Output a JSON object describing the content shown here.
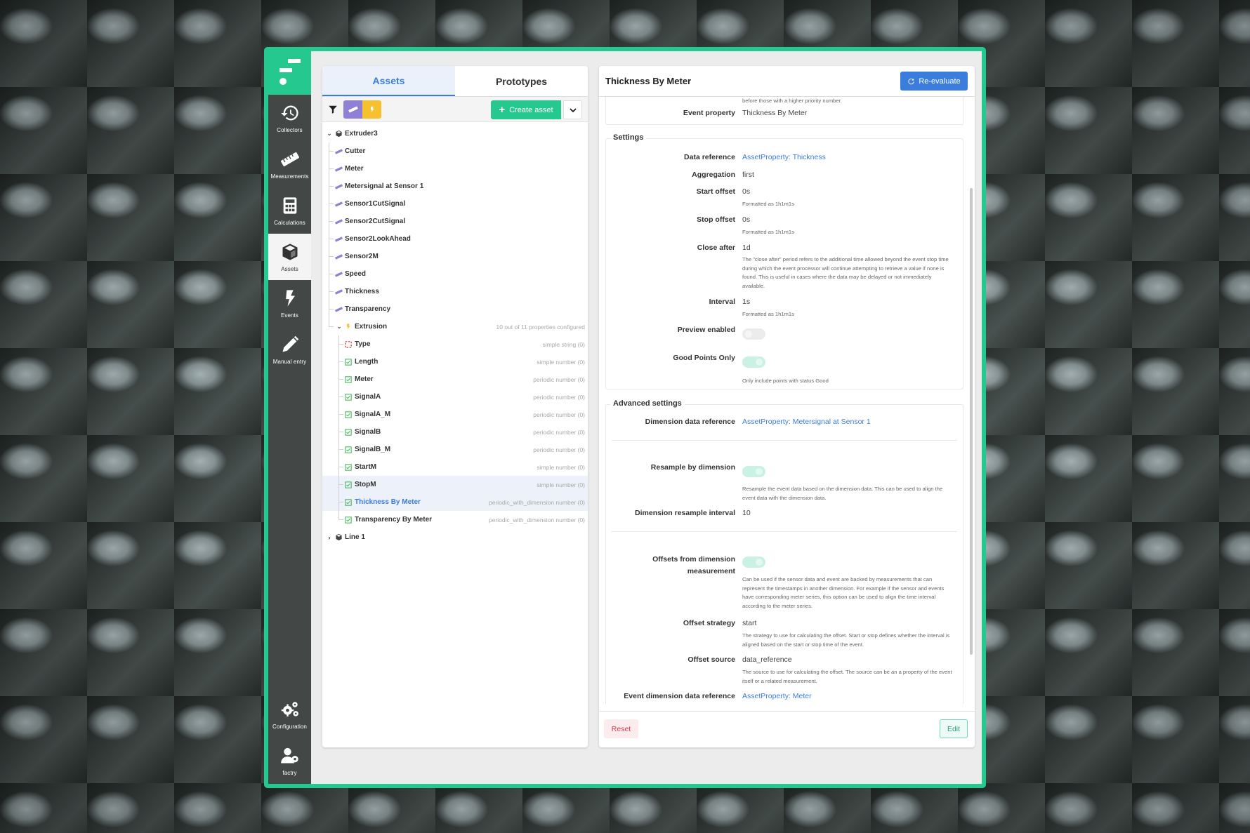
{
  "sidebar": {
    "items": [
      {
        "label": "Collectors",
        "icon": "history-icon"
      },
      {
        "label": "Measurements",
        "icon": "ruler-icon"
      },
      {
        "label": "Calculations",
        "icon": "calculator-icon"
      },
      {
        "label": "Assets",
        "icon": "cube-icon",
        "active": true
      },
      {
        "label": "Events",
        "icon": "bolt-icon"
      },
      {
        "label": "Manual entry",
        "icon": "pencil-icon"
      }
    ],
    "bottom": [
      {
        "label": "Configuration",
        "icon": "gears-icon"
      },
      {
        "label": "factry",
        "icon": "user-gear-icon"
      }
    ]
  },
  "left_panel": {
    "tabs": [
      {
        "label": "Assets",
        "active": true
      },
      {
        "label": "Prototypes",
        "active": false
      }
    ],
    "toolbar": {
      "filter_icon": "filter-icon",
      "chips": [
        {
          "icon": "ruler-icon",
          "color": "#8f7fd6"
        },
        {
          "icon": "bolt-icon",
          "color": "#f5c12f"
        }
      ],
      "create_label": "Create asset"
    },
    "tree": {
      "root": {
        "name": "Extruder3",
        "expanded": true
      },
      "measurements": [
        "Cutter",
        "Meter",
        "Metersignal at Sensor 1",
        "Sensor1CutSignal",
        "Sensor2CutSignal",
        "Sensor2LookAhead",
        "Sensor2M",
        "Speed",
        "Thickness",
        "Transparency"
      ],
      "event": {
        "name": "Extrusion",
        "meta": "10 out of 11 properties configured",
        "expanded": true
      },
      "properties": [
        {
          "name": "Type",
          "meta": "simple string (0)",
          "status": "missing"
        },
        {
          "name": "Length",
          "meta": "simple number (0)",
          "status": "ok"
        },
        {
          "name": "Meter",
          "meta": "periodic number (0)",
          "status": "ok"
        },
        {
          "name": "SignalA",
          "meta": "periodic number (0)",
          "status": "ok"
        },
        {
          "name": "SignalA_M",
          "meta": "periodic number (0)",
          "status": "ok"
        },
        {
          "name": "SignalB",
          "meta": "periodic number (0)",
          "status": "ok"
        },
        {
          "name": "SignalB_M",
          "meta": "periodic number (0)",
          "status": "ok"
        },
        {
          "name": "StartM",
          "meta": "simple number (0)",
          "status": "ok"
        },
        {
          "name": "StopM",
          "meta": "simple number (0)",
          "status": "ok",
          "hover": true
        },
        {
          "name": "Thickness By Meter",
          "meta": "periodic_with_dimension number (0)",
          "status": "ok",
          "selected": true
        },
        {
          "name": "Transparency By Meter",
          "meta": "periodic_with_dimension number (0)",
          "status": "ok"
        }
      ],
      "collapsed_root": {
        "name": "Line 1"
      }
    }
  },
  "right_panel": {
    "title": "Thickness By Meter",
    "reevaluate_label": "Re-evaluate",
    "top": {
      "priority_help_tail": "before those with a higher priority number.",
      "event_property_label": "Event property",
      "event_property_value": "Thickness By Meter"
    },
    "settings": {
      "legend": "Settings",
      "data_reference": {
        "label": "Data reference",
        "value": "AssetProperty: Thickness"
      },
      "aggregation": {
        "label": "Aggregation",
        "value": "first"
      },
      "start_offset": {
        "label": "Start offset",
        "value": "0s",
        "help": "Formatted as 1h1m1s"
      },
      "stop_offset": {
        "label": "Stop offset",
        "value": "0s",
        "help": "Formatted as 1h1m1s"
      },
      "close_after": {
        "label": "Close after",
        "value": "1d",
        "help": "The \"close after\" period refers to the additional time allowed beyond the event stop time during which the event processor will continue attempting to retrieve a value if none is found. This is useful in cases where the data may be delayed or not immediately available."
      },
      "interval": {
        "label": "Interval",
        "value": "1s",
        "help": "Formatted as 1h1m1s"
      },
      "preview_enabled": {
        "label": "Preview enabled",
        "on": false
      },
      "good_points_only": {
        "label": "Good Points Only",
        "on": true,
        "help": "Only include points with status Good"
      }
    },
    "advanced": {
      "legend": "Advanced settings",
      "dimension_data_reference": {
        "label": "Dimension data reference",
        "value": "AssetProperty: Metersignal at Sensor 1"
      },
      "resample_by_dimension": {
        "label": "Resample by dimension",
        "on": true,
        "help": "Resample the event data based on the dimension data. This can be used to align the event data with the dimension data."
      },
      "dimension_resample_interval": {
        "label": "Dimension resample interval",
        "value": "10"
      },
      "offsets_from_dimension": {
        "label": "Offsets from dimension measurement",
        "on": true,
        "help": "Can be used if the sensor data and event are backed by measurements that can represent the timestamps in another dimension. For example if the sensor and events have corresponding meter series, this option can be used to align the time interval according to the meter series."
      },
      "offset_strategy": {
        "label": "Offset strategy",
        "value": "start",
        "help": "The strategy to use for calculating the offset. Start or stop defines whether the interval is aligned based on the start or stop time of the event."
      },
      "offset_source": {
        "label": "Offset source",
        "value": "data_reference",
        "help": "The source to use for calculating the offset. The source can be an a property of the event itself or a related measurement."
      },
      "event_dimension_data_reference": {
        "label": "Event dimension data reference",
        "value": "AssetProperty: Meter"
      }
    },
    "footer": {
      "reset_label": "Reset",
      "edit_label": "Edit"
    }
  },
  "colors": {
    "brand": "#25c990",
    "accent": "#3b7ddd",
    "sidebar": "#434847",
    "danger": "#d23a4f"
  }
}
